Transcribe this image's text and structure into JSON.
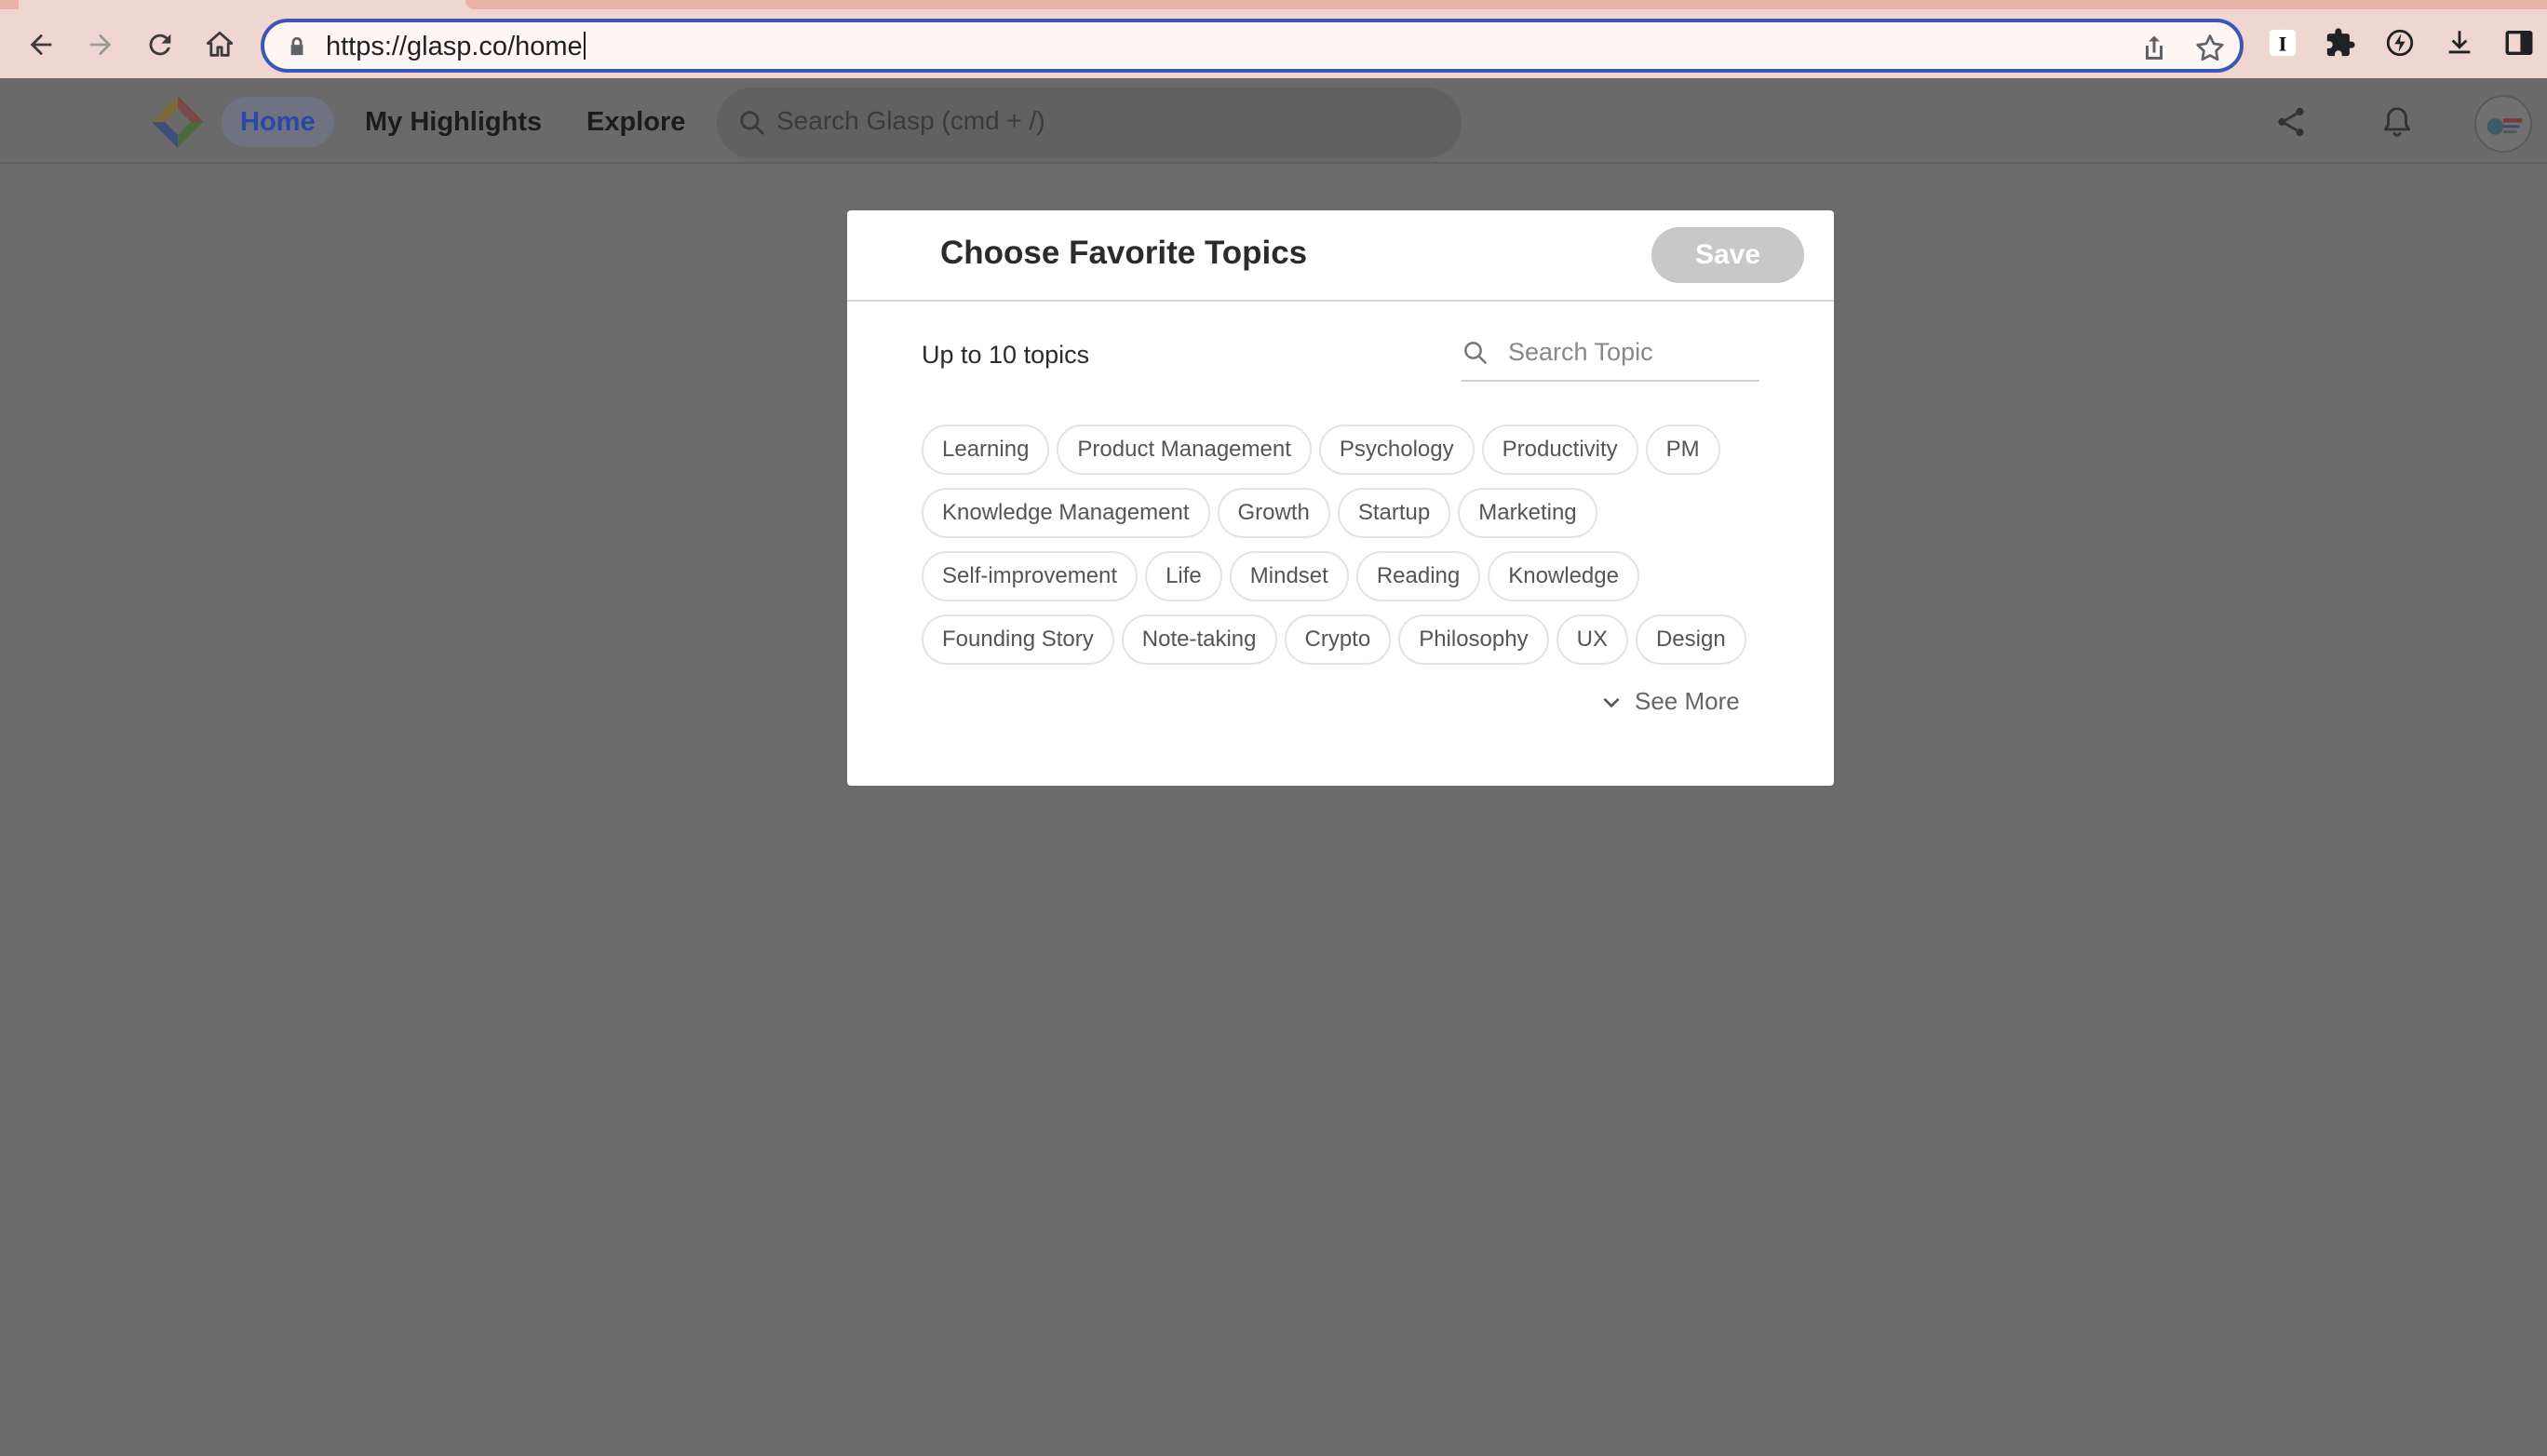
{
  "browser": {
    "url_host": "https://glasp.co",
    "url_path": "/home"
  },
  "header": {
    "nav": {
      "home": "Home",
      "my_highlights": "My Highlights",
      "explore": "Explore"
    },
    "search_placeholder": "Search Glasp (cmd + /)"
  },
  "modal": {
    "title": "Choose Favorite Topics",
    "save_label": "Save",
    "limit_text": "Up to 10 topics",
    "search_placeholder": "Search Topic",
    "see_more_label": "See More",
    "topic_rows": [
      [
        "Learning",
        "Product Management",
        "Psychology",
        "Productivity",
        "PM"
      ],
      [
        "Knowledge Management",
        "Growth",
        "Startup",
        "Marketing"
      ],
      [
        "Self-improvement",
        "Life",
        "Mindset",
        "Reading",
        "Knowledge"
      ],
      [
        "Founding Story",
        "Note-taking",
        "Crypto",
        "Philosophy",
        "UX",
        "Design"
      ]
    ]
  },
  "colors": {
    "overlay": "#6b6b6b",
    "chrome": "#f0d6d0",
    "omnibox_border": "#3a57b8",
    "save_disabled": "#c8c8c8"
  }
}
